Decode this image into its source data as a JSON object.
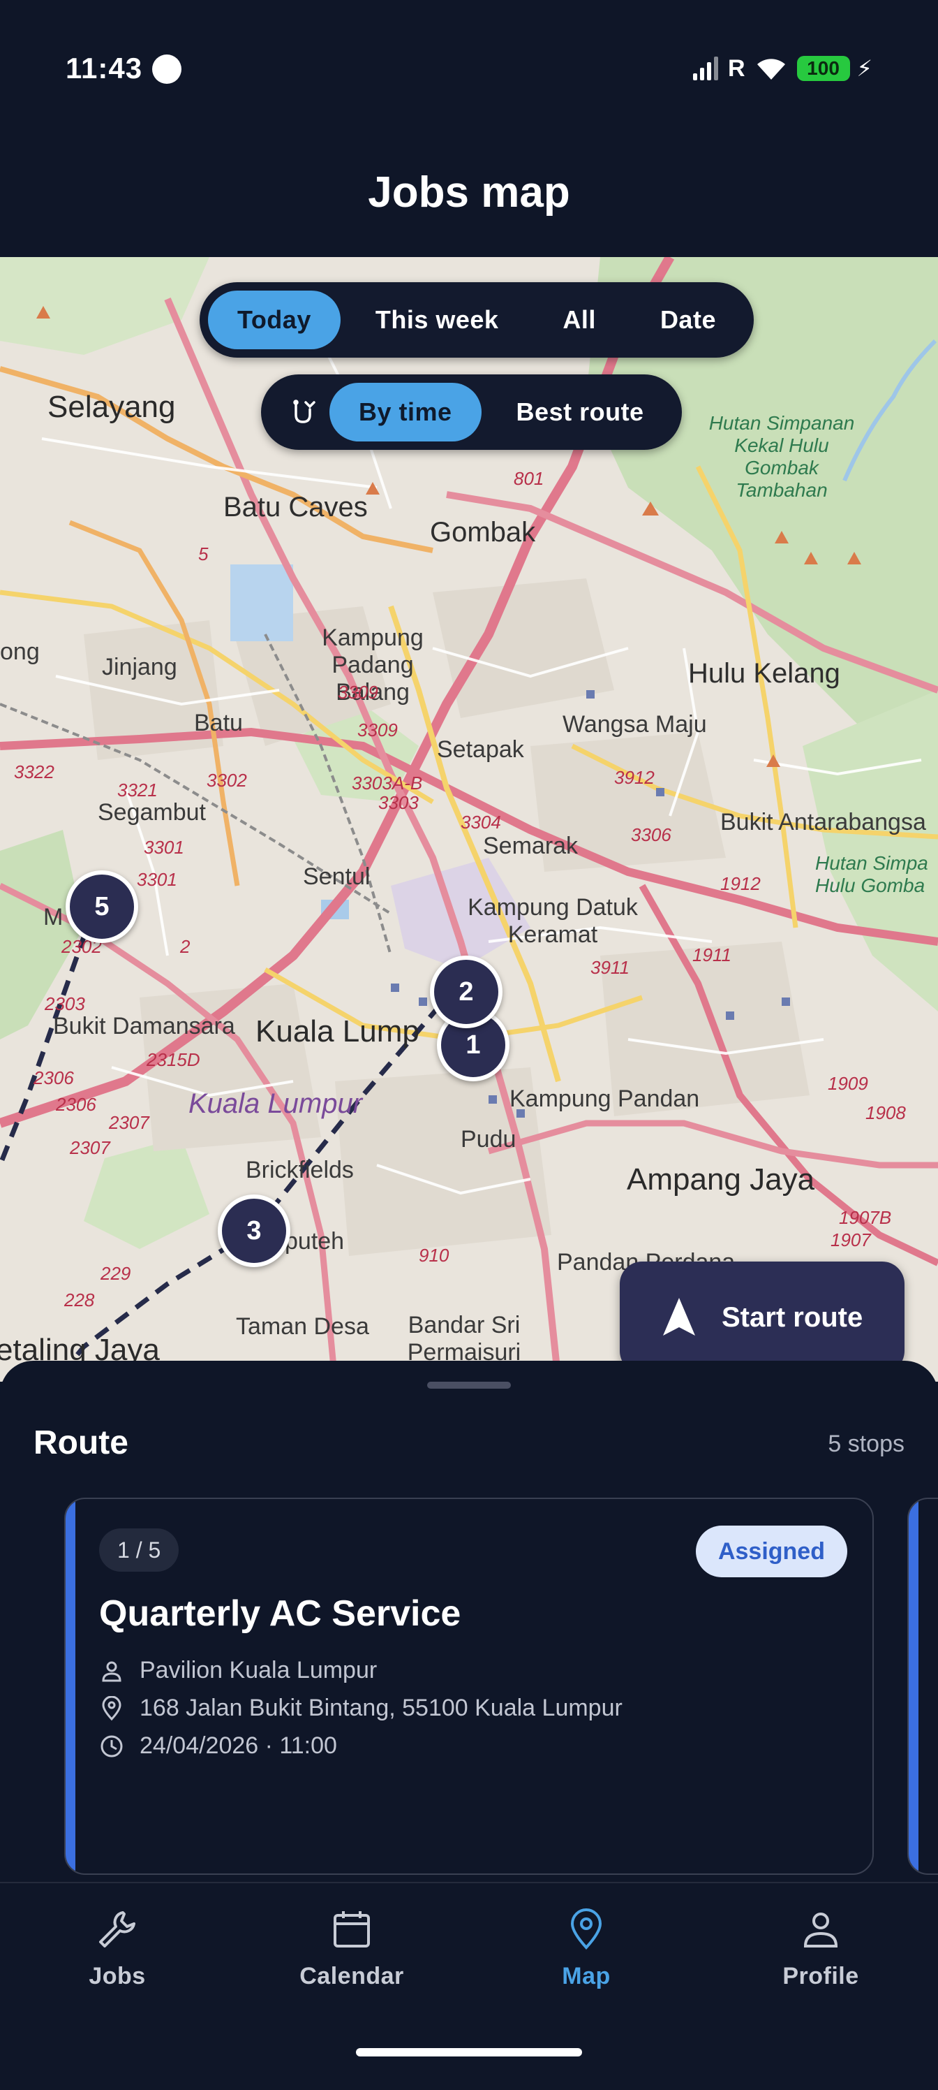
{
  "status_bar": {
    "time": "11:43",
    "carrier_indicator": "R",
    "battery": "100"
  },
  "header": {
    "title": "Jobs map"
  },
  "filters": {
    "range_chips": [
      {
        "label": "Today",
        "active": true
      },
      {
        "label": "This week",
        "active": false
      },
      {
        "label": "All",
        "active": false
      },
      {
        "label": "Date",
        "active": false
      }
    ],
    "sort_chips": [
      {
        "label": "By time",
        "active": true
      },
      {
        "label": "Best route",
        "active": false
      }
    ]
  },
  "map": {
    "labels": {
      "selayang": "Selayang",
      "batu_caves": "Batu Caves",
      "gombak": "Gombak",
      "hutan": "Hutan Simpanan Kekal Hulu Gombak Tambahan",
      "kampung_padang_balang": "Kampung Padang Balang",
      "jinjang": "Jinjang",
      "batu": "Batu",
      "setapak": "Setapak",
      "wangsa_maju": "Wangsa Maju",
      "hulu_kelang": "Hulu Kelang",
      "segambut": "Segambut",
      "semarak": "Semarak",
      "bukit_antarabangsa": "Bukit Antarabangsa",
      "hutan_simpan_right": "Hutan Simpa Hulu Gomba",
      "sentul": "Sentul",
      "kampung_datuk_keramat": "Kampung Datuk Keramat",
      "bukit_damansara": "Bukit Damansara",
      "kuala_lumpur": "Kuala Lump",
      "kuala_lumpur_violet": "Kuala Lumpur",
      "kampung_pandan": "Kampung Pandan",
      "pudu": "Pudu",
      "ampang_jaya": "Ampang Jaya",
      "brickfields": "Brickfields",
      "seputeh": "puteh",
      "pandan_perdana": "Pandan Perdana",
      "taman_desa": "Taman Desa",
      "bandar_sri_permaisuri": "Bandar Sri Permaisuri",
      "petaling_jaya": "etaling Jaya",
      "ong": "ong",
      "mara": "M      ara",
      "road_801": "801",
      "road_3309a": "3309",
      "road_3309b": "3309",
      "road_3302": "3302",
      "road_3303ab": "3303A-B",
      "road_3303": "3303",
      "road_3304": "3304",
      "road_3912": "3912",
      "road_3306": "3306",
      "road_1912": "1912",
      "road_3322": "3322",
      "road_3321": "3321",
      "road_3301a": "3301",
      "road_3301b": "3301",
      "road_1911": "1911",
      "road_3911": "3911",
      "road_2315d": "2315D",
      "road_2306a": "2306",
      "road_2306b": "2306",
      "road_2307a": "2307",
      "road_2307b": "2307",
      "road_1909": "1909",
      "road_1908": "1908",
      "road_1907b": "1907B",
      "road_1907": "1907",
      "road_910": "910",
      "road_229": "229",
      "road_228": "228",
      "road_2303": "2303",
      "road_2302": "2302",
      "road_5": "5",
      "road_2": "2"
    },
    "markers": [
      "1",
      "2",
      "3",
      "5"
    ]
  },
  "start_route": {
    "label": "Start route"
  },
  "route_sheet": {
    "title": "Route",
    "count": "5 stops",
    "card": {
      "step": "1 / 5",
      "status": "Assigned",
      "title": "Quarterly AC Service",
      "customer": "Pavilion Kuala Lumpur",
      "address": "168 Jalan Bukit Bintang, 55100 Kuala Lumpur",
      "datetime": "24/04/2026 · 11:00"
    }
  },
  "nav": {
    "items": [
      {
        "label": "Jobs",
        "icon": "wrench-icon",
        "active": false
      },
      {
        "label": "Calendar",
        "icon": "calendar-icon",
        "active": false
      },
      {
        "label": "Map",
        "icon": "map-pin-icon",
        "active": true
      },
      {
        "label": "Profile",
        "icon": "person-icon",
        "active": false
      }
    ]
  },
  "colors": {
    "background": "#0f1628",
    "accent": "#4aa3e6",
    "marker": "#2b2d52",
    "card_accent": "#3b6fe0",
    "badge_bg": "#dbe6fb",
    "badge_text": "#2f5fc8"
  }
}
